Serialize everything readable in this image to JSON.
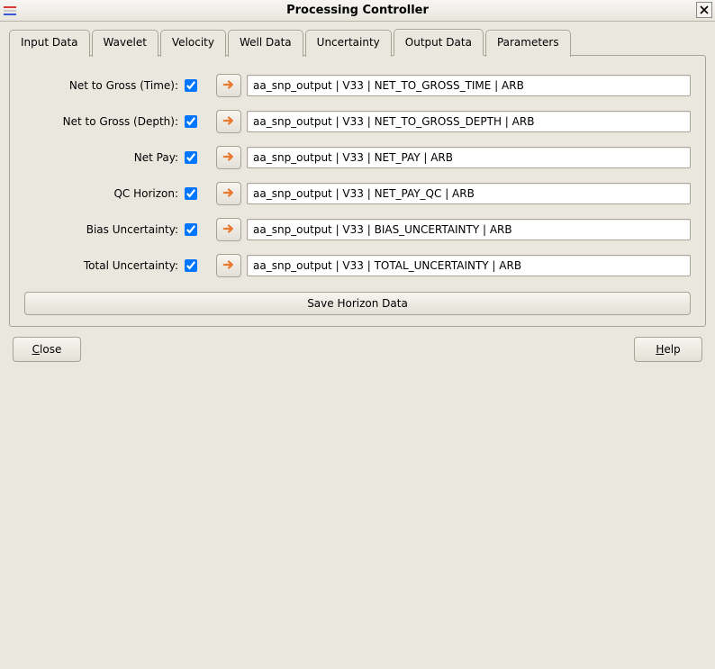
{
  "window": {
    "title": "Processing Controller"
  },
  "tabs": {
    "items": [
      {
        "label": "Input Data"
      },
      {
        "label": "Wavelet"
      },
      {
        "label": "Velocity"
      },
      {
        "label": "Well Data"
      },
      {
        "label": "Uncertainty"
      },
      {
        "label": "Output Data"
      },
      {
        "label": "Parameters"
      }
    ],
    "active_index": 5
  },
  "output_data": {
    "rows": [
      {
        "label": "Net to Gross (Time):",
        "checked": true,
        "value": "aa_snp_output | V33 | NET_TO_GROSS_TIME | ARB"
      },
      {
        "label": "Net to Gross (Depth):",
        "checked": true,
        "value": "aa_snp_output | V33 | NET_TO_GROSS_DEPTH | ARB"
      },
      {
        "label": "Net Pay:",
        "checked": true,
        "value": "aa_snp_output | V33 | NET_PAY | ARB"
      },
      {
        "label": "QC Horizon:",
        "checked": true,
        "value": "aa_snp_output | V33 | NET_PAY_QC | ARB"
      },
      {
        "label": "Bias Uncertainty:",
        "checked": true,
        "value": "aa_snp_output | V33 | BIAS_UNCERTAINTY | ARB"
      },
      {
        "label": "Total Uncertainty:",
        "checked": true,
        "value": "aa_snp_output | V33 | TOTAL_UNCERTAINTY | ARB"
      }
    ],
    "save_button": "Save Horizon Data"
  },
  "buttons": {
    "close": "Close",
    "help": "Help"
  },
  "colors": {
    "accent_arrow": "#e9792c"
  }
}
